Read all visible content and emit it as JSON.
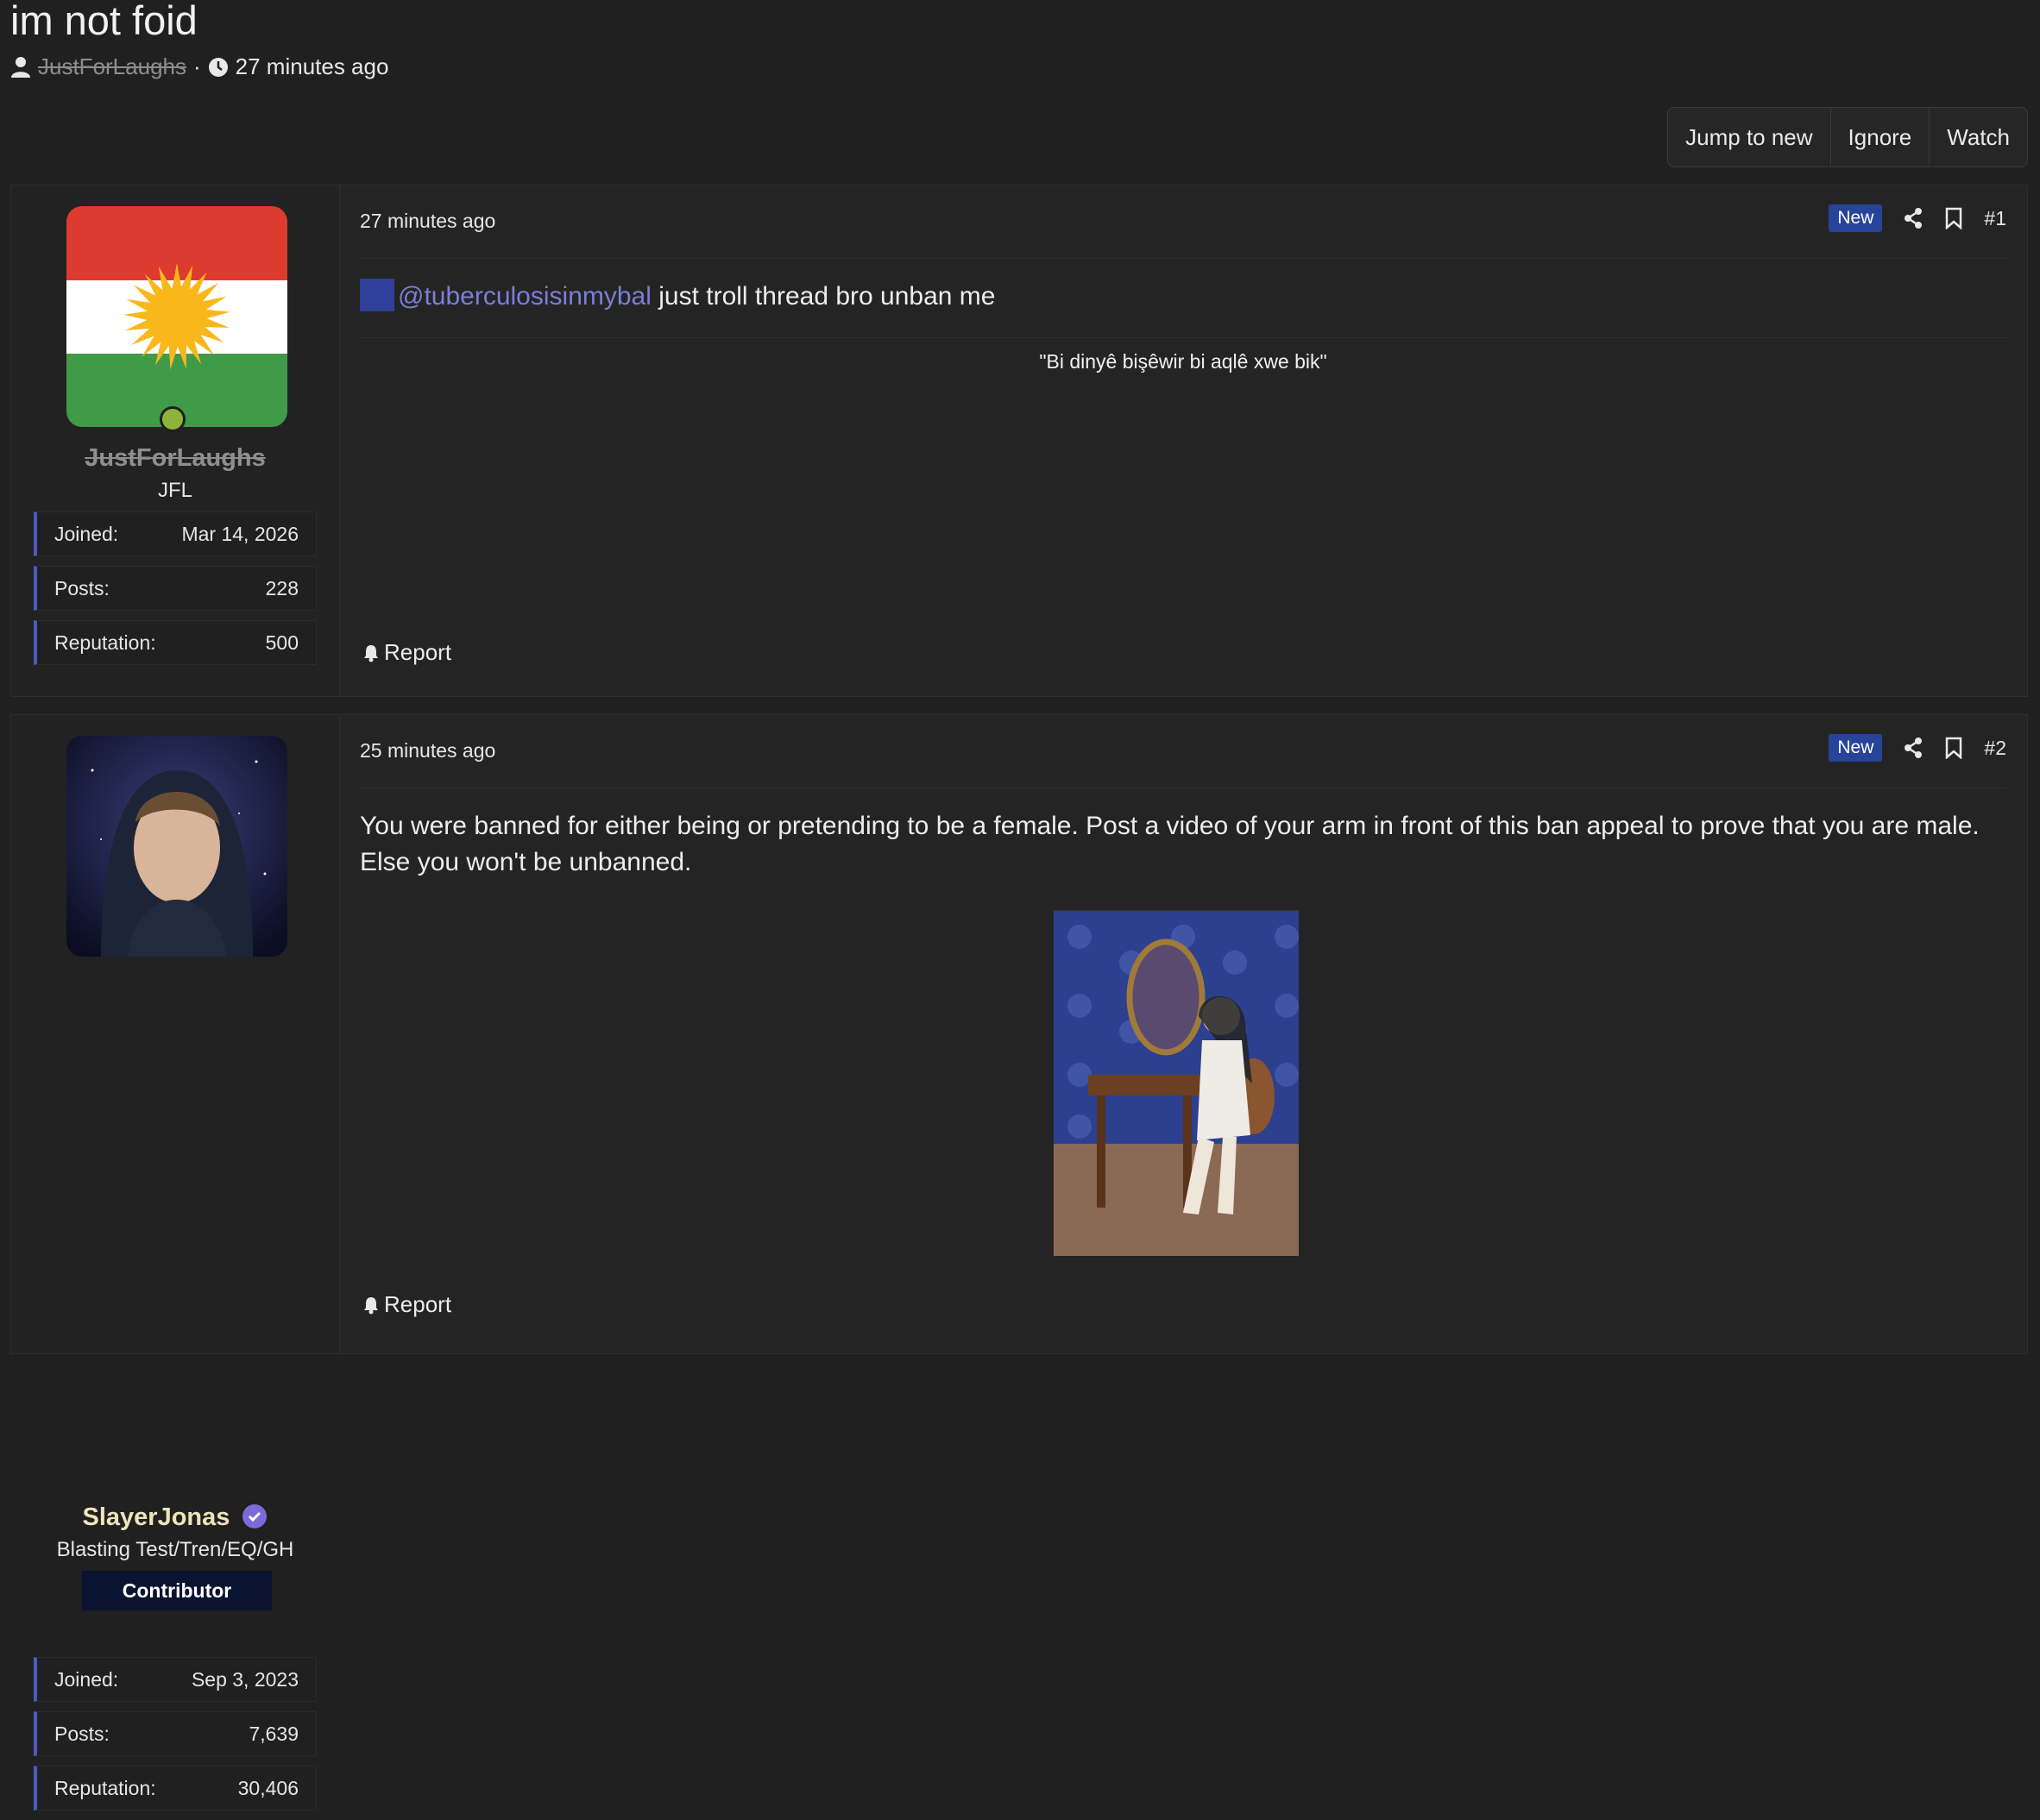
{
  "thread": {
    "title": "im not foid",
    "author": "JustForLaughs",
    "separator": "·",
    "time": "27 minutes ago"
  },
  "toolbar": {
    "jump_label": "Jump to new",
    "ignore_label": "Ignore",
    "watch_label": "Watch"
  },
  "posts": [
    {
      "username": "JustForLaughs",
      "user_title": "JFL",
      "stats": [
        {
          "label": "Joined:",
          "value": "Mar 14, 2026"
        },
        {
          "label": "Posts:",
          "value": "228"
        },
        {
          "label": "Reputation:",
          "value": "500"
        }
      ],
      "time": "27 minutes ago",
      "badge": "New",
      "number": "#1",
      "mention": "@tuberculosisinmybal",
      "text": " just troll thread bro unban me",
      "signature": "\"Bi dinyê bişêwir bi aqlê xwe bik\"",
      "report_label": "Report"
    },
    {
      "username": "SlayerJonas",
      "user_title": "Blasting Test/Tren/EQ/GH",
      "banner": "Contributor",
      "stats": [
        {
          "label": "Joined:",
          "value": "Sep 3, 2023"
        },
        {
          "label": "Posts:",
          "value": "7,639"
        },
        {
          "label": "Reputation:",
          "value": "30,406"
        }
      ],
      "time": "25 minutes ago",
      "badge": "New",
      "number": "#2",
      "text": "You were banned for either being or pretending to be a female. Post a video of your arm in front of this ban appeal to prove that you are male. Else you won't be unbanned.",
      "report_label": "Report"
    }
  ],
  "colors": {
    "background": "#202020",
    "accent": "#4a5cc0",
    "badge": "#28439a",
    "mention": "#7b7fd6",
    "online": "#8db43a"
  }
}
